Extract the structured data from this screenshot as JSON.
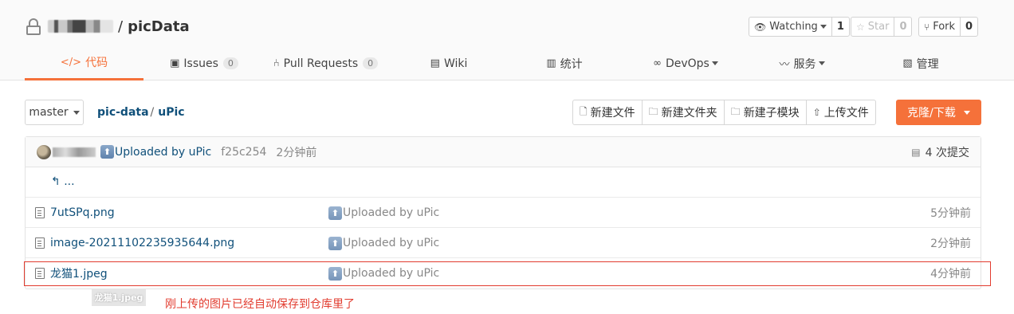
{
  "repo": {
    "sep": "/",
    "name": "picData"
  },
  "header_buttons": {
    "watch": {
      "label": "Watching",
      "count": "1"
    },
    "star": {
      "label": "Star",
      "count": "0"
    },
    "fork": {
      "label": "Fork",
      "count": "0"
    }
  },
  "nav": {
    "code": "代码",
    "issues": "Issues",
    "issues_count": "0",
    "pulls": "Pull Requests",
    "pulls_count": "0",
    "wiki": "Wiki",
    "stats": "统计",
    "devops": "DevOps",
    "services": "服务",
    "manage": "管理"
  },
  "toolbar": {
    "branch": "master",
    "breadcrumb_root": "pic-data",
    "breadcrumb_sep": "/",
    "breadcrumb_dir": "uPic",
    "new_file": "新建文件",
    "new_folder": "新建文件夹",
    "new_submodule": "新建子模块",
    "upload": "上传文件",
    "clone": "克隆/下载"
  },
  "commit": {
    "message": "Uploaded by uPic",
    "sha": "f25c254",
    "time": "2分钟前",
    "count": "4 次提交"
  },
  "files": [
    {
      "name": "7utSPq.png",
      "commit": "Uploaded by uPic",
      "time": "5分钟前"
    },
    {
      "name": "image-20211102235935644.png",
      "commit": "Uploaded by uPic",
      "time": "2分钟前"
    },
    {
      "name": "龙猫1.jpeg",
      "commit": "Uploaded by uPic",
      "time": "4分钟前"
    }
  ],
  "parent_dir": "...",
  "tooltip": "龙猫1.jpeg",
  "annotation": "刚上传的图片已经自动保存到仓库里了",
  "colors": {
    "accent": "#f5713a",
    "link": "#10507a",
    "annotation": "#e23c2f"
  }
}
